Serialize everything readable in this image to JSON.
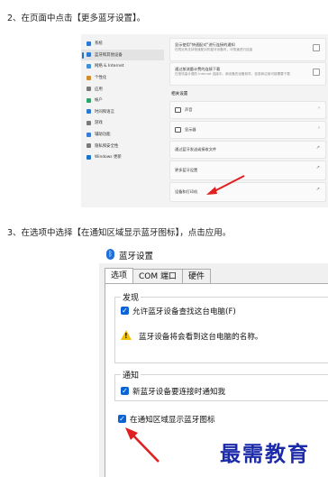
{
  "steps": {
    "step1": "2、在页面中点击【更多蓝牙设置】。",
    "step2": "3、在选项中选择【在通知区域显示蓝牙图标】，点击应用。"
  },
  "settings": {
    "sidebar": [
      {
        "label": "系统",
        "color": "#2b79d0"
      },
      {
        "label": "蓝牙和其他设备",
        "color": "#2b79d0",
        "active": true
      },
      {
        "label": "网络 & Internet",
        "color": "#3f8fd8"
      },
      {
        "label": "个性化",
        "color": "#d08b2b"
      },
      {
        "label": "应用",
        "color": "#7a7a7a"
      },
      {
        "label": "帐户",
        "color": "#2ea36b"
      },
      {
        "label": "时间和语言",
        "color": "#2b79d0"
      },
      {
        "label": "游戏",
        "color": "#7a7a7a"
      },
      {
        "label": "辅助功能",
        "color": "#3a7bd5"
      },
      {
        "label": "隐私和安全性",
        "color": "#7a7a7a"
      },
      {
        "label": "Windows 更新",
        "color": "#1a73c9"
      }
    ],
    "cards": {
      "card1_title": "显示使用\"快速配对\"进行连接的通知",
      "card1_sub": "在附近有支持快速配对的蓝牙设备时，可快速进行连接",
      "card2_title": "通过按流量计费的连接下载",
      "card2_sub": "在按流量计费的 Internet 连接中，新设备的设备软件、信息和应用可能需要下载",
      "related_title": "相关设置",
      "sound": "声音",
      "display": "显示器",
      "send_receive": "通过蓝牙发送或接收文件",
      "more_bt": "更多蓝牙设置",
      "printers": "设备和打印机"
    }
  },
  "dialog": {
    "title": "蓝牙设置",
    "tabs": [
      "选项",
      "COM 端口",
      "硬件"
    ],
    "discovery_title": "发现",
    "allow_discover": "允许蓝牙设备查找这台电脑(F)",
    "warning": "蓝牙设备将会看到这台电脑的名称。",
    "notify_title": "通知",
    "notify_new": "新蓝牙设备要连接时通知我",
    "show_tray": "在通知区域显示蓝牙图标"
  },
  "watermark": "最需教育",
  "colors": {
    "accent": "#0a64d6",
    "arrow": "#e02020",
    "watermark": "#1b2aa8"
  }
}
